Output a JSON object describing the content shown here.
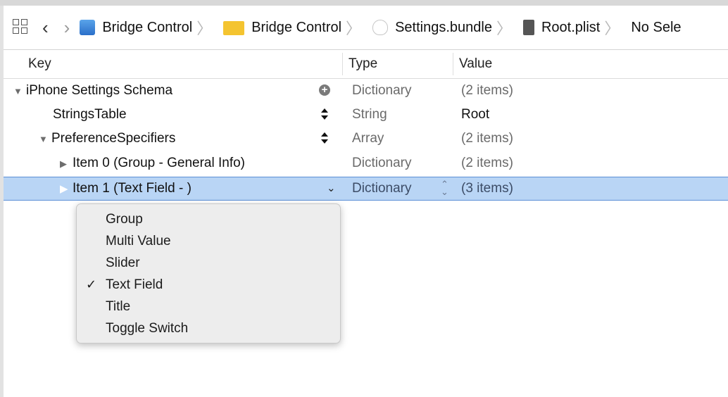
{
  "jumpbar": {
    "crumbs": [
      {
        "label": "Bridge Control",
        "icon": "app-icon"
      },
      {
        "label": "Bridge Control",
        "icon": "folder-icon"
      },
      {
        "label": "Settings.bundle",
        "icon": "bundle-icon"
      },
      {
        "label": "Root.plist",
        "icon": "plist-file-icon"
      },
      {
        "label": "No Sele",
        "icon": ""
      }
    ]
  },
  "columns": {
    "key": "Key",
    "type": "Type",
    "value": "Value"
  },
  "rows": [
    {
      "key": "iPhone Settings Schema",
      "type": "Dictionary",
      "value": "(2 items)",
      "disclosure": "expanded"
    },
    {
      "key": "StringsTable",
      "type": "String",
      "value": "Root",
      "disclosure": "none"
    },
    {
      "key": "PreferenceSpecifiers",
      "type": "Array",
      "value": "(2 items)",
      "disclosure": "expanded"
    },
    {
      "key": "Item 0 (Group - General Info)",
      "type": "Dictionary",
      "value": "(2 items)",
      "disclosure": "collapsed"
    },
    {
      "key": "Item 1 (Text Field - )",
      "type": "Dictionary",
      "value": "(3 items)",
      "disclosure": "collapsed",
      "selected": true
    }
  ],
  "menu": {
    "items": [
      {
        "label": "Group",
        "checked": false
      },
      {
        "label": "Multi Value",
        "checked": false
      },
      {
        "label": "Slider",
        "checked": false
      },
      {
        "label": "Text Field",
        "checked": true
      },
      {
        "label": "Title",
        "checked": false
      },
      {
        "label": "Toggle Switch",
        "checked": false
      }
    ],
    "check_glyph": "✓"
  },
  "colors": {
    "selection": "#b9d5f5",
    "folder": "#f4c430"
  }
}
